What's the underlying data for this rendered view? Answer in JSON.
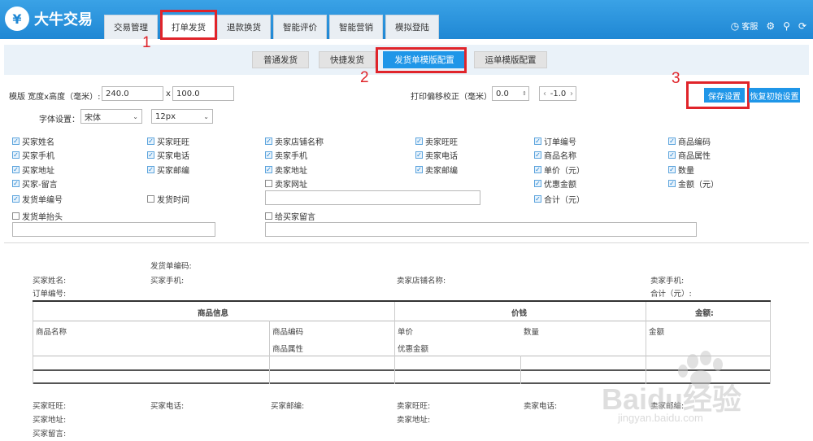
{
  "header": {
    "logo_text": "大牛交易",
    "logo_mark": "¥",
    "tabs": [
      "交易管理",
      "打单发货",
      "退款换货",
      "智能评价",
      "智能营销",
      "模拟登陆"
    ],
    "right": {
      "service": "客服"
    }
  },
  "subtabs": [
    "普通发货",
    "快捷发货",
    "发货单模版配置",
    "运单模版配置"
  ],
  "annotations": [
    "1",
    "2",
    "3"
  ],
  "settings": {
    "size_label": "模版 宽度x高度（毫米）:",
    "width_value": "240.0",
    "times": "x",
    "height_value": "100.0",
    "offset_label": "打印偏移校正（毫米）:",
    "offset_x": "0.0",
    "offset_y": "-1.0",
    "save_label": "保存设置",
    "reset_label": "恢复初始设置",
    "font_label": "字体设置：",
    "font_family": "宋体",
    "font_size": "12px"
  },
  "fields": {
    "col1": [
      {
        "label": "买家姓名",
        "checked": true
      },
      {
        "label": "买家手机",
        "checked": true
      },
      {
        "label": "买家地址",
        "checked": true
      },
      {
        "label": "买家-留言",
        "checked": true
      },
      {
        "label": "发货单编号",
        "checked": true
      },
      {
        "label": "发货单抬头",
        "checked": false
      }
    ],
    "col2": [
      {
        "label": "买家旺旺",
        "checked": true
      },
      {
        "label": "买家电话",
        "checked": true
      },
      {
        "label": "买家邮编",
        "checked": true
      },
      {
        "label": "发货时间",
        "checked": false
      }
    ],
    "col3": [
      {
        "label": "卖家店铺名称",
        "checked": true
      },
      {
        "label": "卖家手机",
        "checked": true
      },
      {
        "label": "卖家地址",
        "checked": true
      },
      {
        "label": "卖家网址",
        "checked": false
      },
      {
        "label": "给买家留言",
        "checked": false
      }
    ],
    "col4": [
      {
        "label": "卖家旺旺",
        "checked": true
      },
      {
        "label": "卖家电话",
        "checked": true
      },
      {
        "label": "卖家邮编",
        "checked": true
      }
    ],
    "col5": [
      {
        "label": "订单编号",
        "checked": true
      },
      {
        "label": "商品名称",
        "checked": true
      },
      {
        "label": "单价（元）",
        "checked": true
      },
      {
        "label": "优惠金额",
        "checked": true
      },
      {
        "label": "合计（元）",
        "checked": true
      }
    ],
    "col6": [
      {
        "label": "商品编码",
        "checked": true
      },
      {
        "label": "商品属性",
        "checked": true
      },
      {
        "label": "数量",
        "checked": true
      },
      {
        "label": "金额（元）",
        "checked": true
      }
    ]
  },
  "preview": {
    "invoice_no": "发货单编码:",
    "buyer_name": "买家姓名:",
    "buyer_mobile": "买家手机:",
    "shop_name": "卖家店铺名称:",
    "seller_mobile": "卖家手机:",
    "order_no": "订单编号:",
    "total": "合计（元）:",
    "table": {
      "group_headers": [
        "商品信息",
        "价钱",
        "金额:"
      ],
      "row1": [
        "商品名称",
        "商品编码",
        "单价",
        "数量",
        "金额"
      ],
      "row2": [
        "商品属性",
        "优惠金额"
      ]
    },
    "footer": {
      "buyer_ww": "买家旺旺:",
      "buyer_phone": "买家电话:",
      "buyer_zip": "买家邮编:",
      "seller_ww": "卖家旺旺:",
      "seller_phone": "卖家电话:",
      "seller_zip": "卖家邮编:",
      "buyer_addr": "买家地址:",
      "seller_addr": "卖家地址:",
      "buyer_msg": "买家留言:"
    }
  },
  "watermark": {
    "brand": "Baidu经验",
    "url": "jingyan.baidu.com"
  },
  "colors": {
    "topbar": "#2a94dc",
    "accent": "#1f96e8",
    "annotation": "#e0242a"
  }
}
